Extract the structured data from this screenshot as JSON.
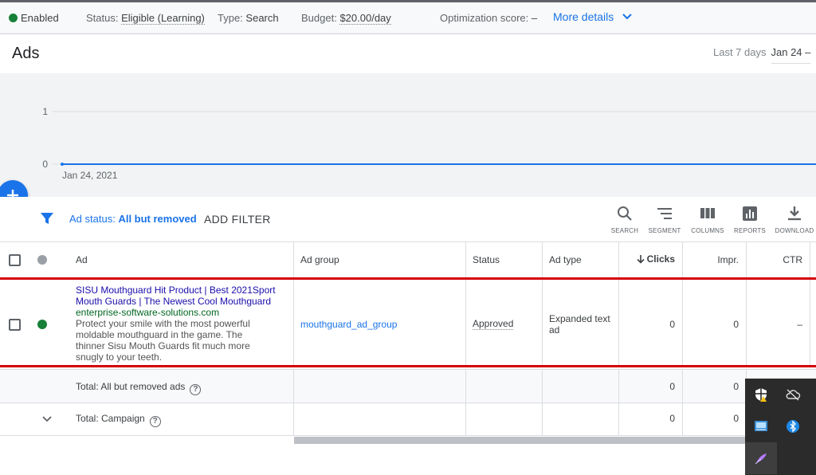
{
  "status_bar": {
    "enabled_label": "Enabled",
    "status_label": "Status:",
    "status_value": "Eligible (Learning)",
    "type_label": "Type:",
    "type_value": "Search",
    "budget_label": "Budget:",
    "budget_value": "$20.00/day",
    "opt_label": "Optimization score:",
    "opt_value": "–",
    "more_details": "More details"
  },
  "header": {
    "title": "Ads",
    "range_label": "Last 7 days",
    "range_value": "Jan 24 –"
  },
  "chart_data": {
    "type": "line",
    "x": [
      "Jan 24, 2021"
    ],
    "series": [
      {
        "values": [
          0
        ]
      }
    ],
    "y_ticks": [
      "1",
      "0"
    ],
    "ylim": [
      0,
      1
    ],
    "grid": true
  },
  "toolbar": {
    "filter_prefix": "Ad status:",
    "filter_value": "All but removed",
    "add_filter": "ADD FILTER",
    "tools": {
      "search": "SEARCH",
      "segment": "SEGMENT",
      "columns": "COLUMNS",
      "reports": "REPORTS",
      "download": "DOWNLOAD"
    }
  },
  "table": {
    "headers": {
      "ad": "Ad",
      "ad_group": "Ad group",
      "status": "Status",
      "ad_type": "Ad type",
      "clicks": "Clicks",
      "impr": "Impr.",
      "ctr": "CTR"
    },
    "row": {
      "title_line1": "SISU Mouthguard Hit Product | Best 2021Sport",
      "title_line2": "Mouth Guards | The Newest Cool Mouthguard",
      "url": "enterprise-software-solutions.com",
      "desc_line1": "Protect your smile with the most powerful",
      "desc_line2": "moldable mouthguard in the game. The",
      "desc_line3": "thinner Sisu Mouth Guards fit much more",
      "desc_line4": "snugly to your teeth.",
      "ad_group": "mouthguard_ad_group",
      "status": "Approved",
      "ad_type_line1": "Expanded text",
      "ad_type_line2": "ad",
      "clicks": "0",
      "impr": "0",
      "ctr": "–"
    },
    "total_removed": {
      "label": "Total: All but removed ads",
      "clicks": "0",
      "impr": "0"
    },
    "total_campaign": {
      "label": "Total: Campaign",
      "clicks": "0",
      "impr": "0"
    }
  },
  "colors": {
    "accent": "#1a73e8",
    "enabled_green": "#188038",
    "highlight_red": "#d50000"
  },
  "tray_icons": [
    "security-warning-icon",
    "cloud-offline-icon",
    "network-app-icon",
    "bluetooth-icon",
    "feather-pen-icon"
  ]
}
